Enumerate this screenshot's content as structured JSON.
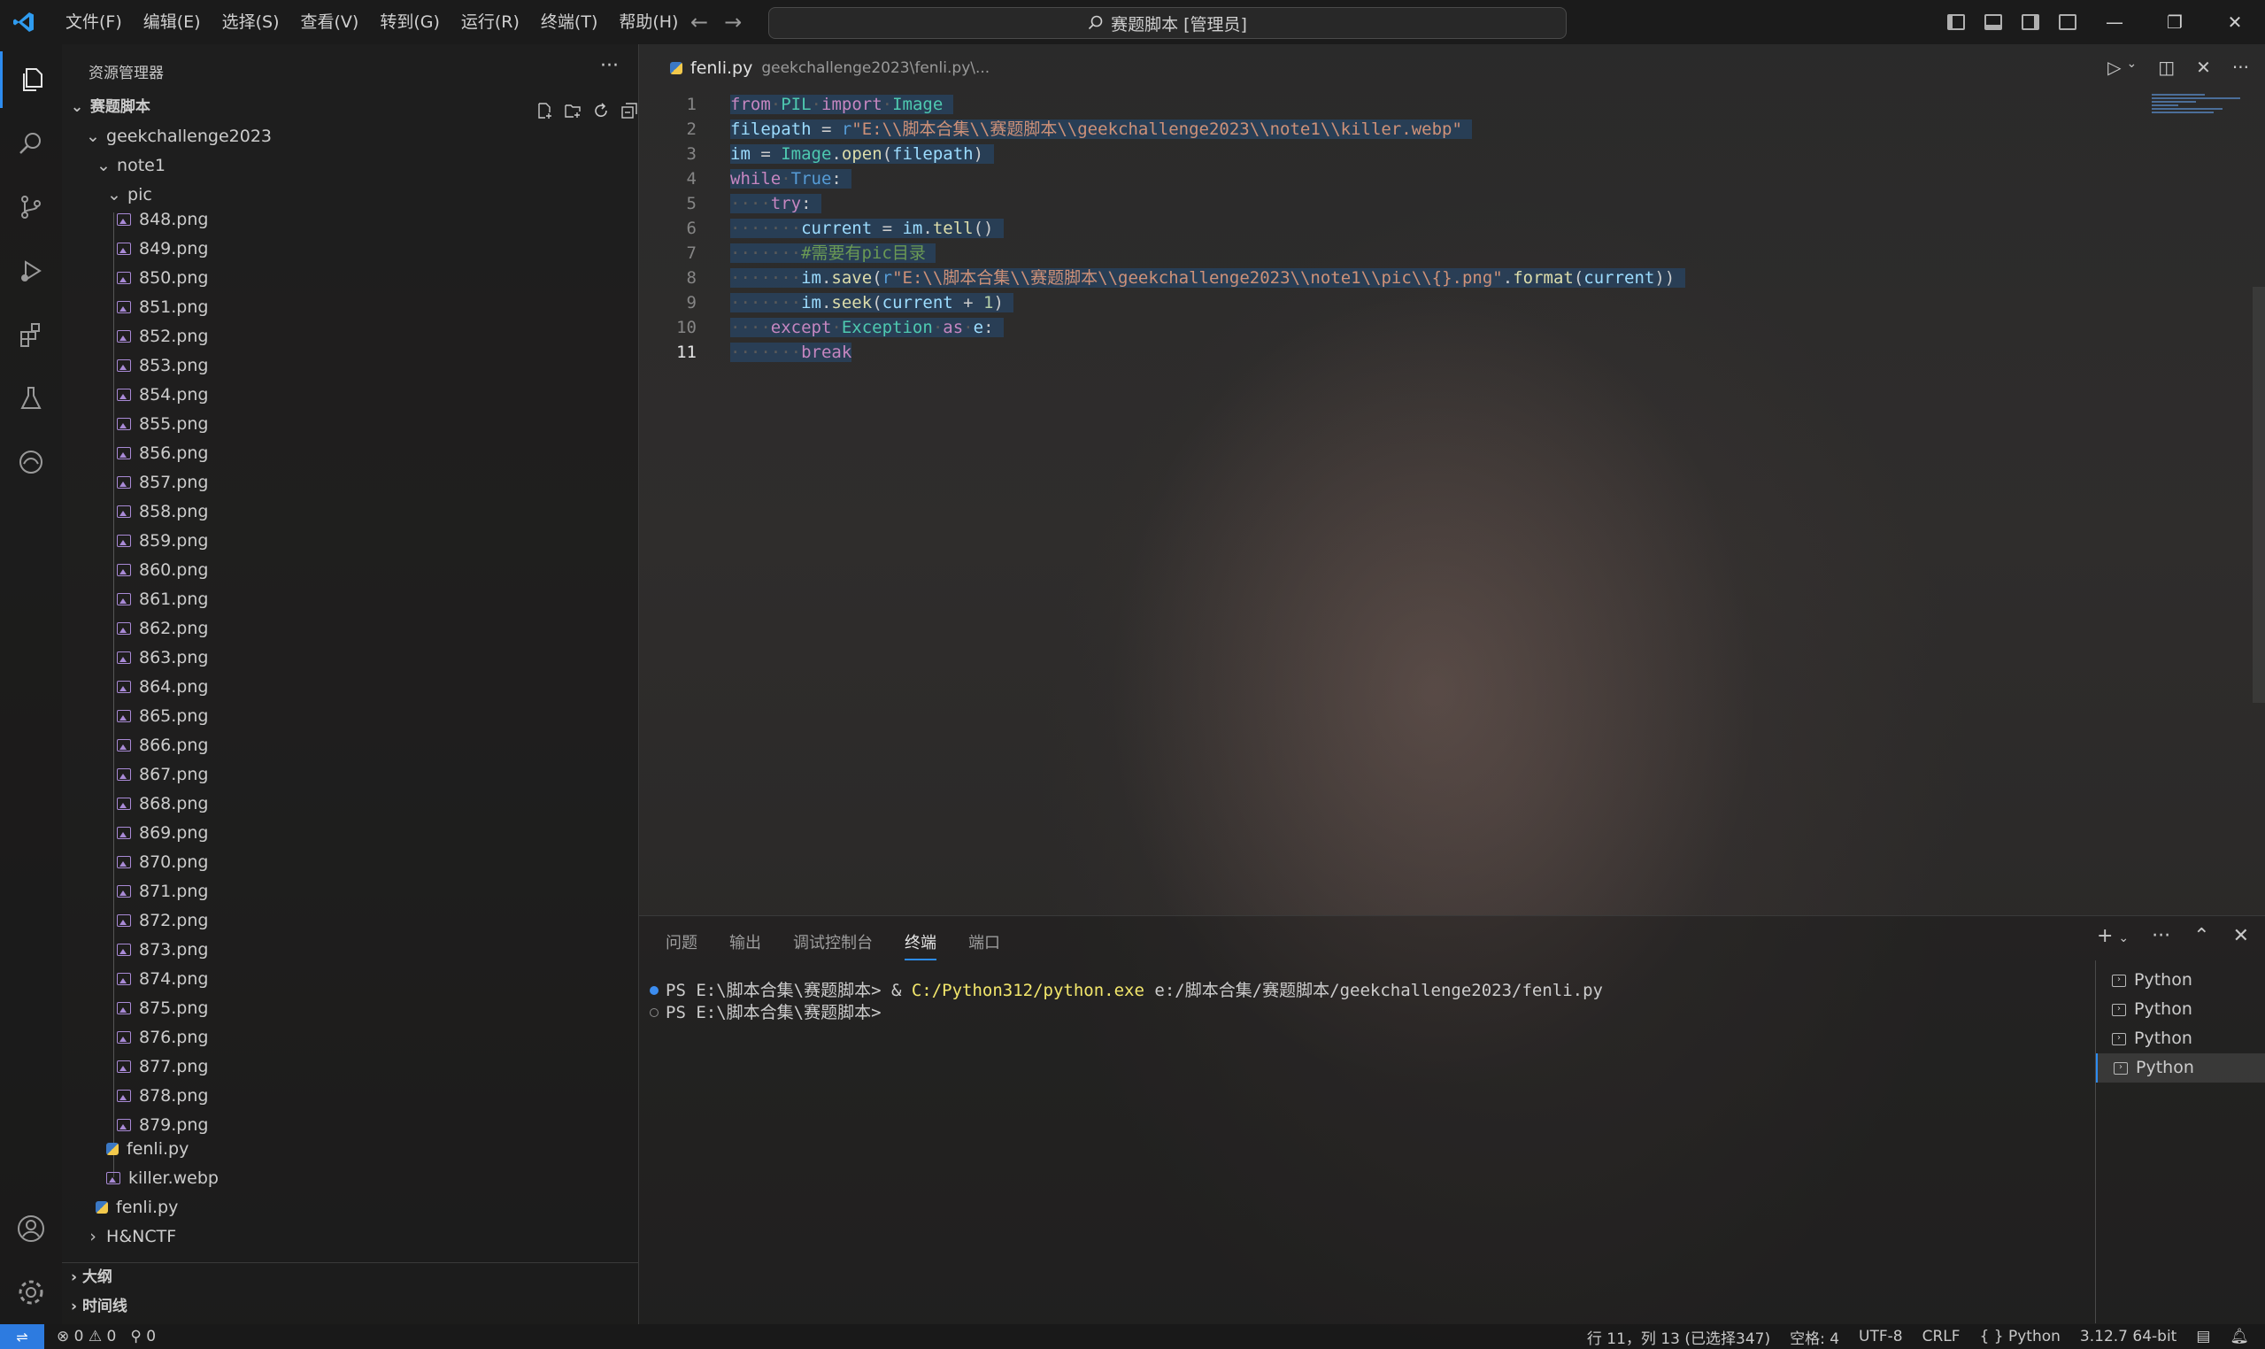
{
  "title_bar": {
    "menu": [
      "文件(F)",
      "编辑(E)",
      "选择(S)",
      "查看(V)",
      "转到(G)",
      "运行(R)",
      "终端(T)",
      "帮助(H)"
    ],
    "search_text": "赛题脚本 [管理员]"
  },
  "sidebar": {
    "header": "资源管理器",
    "project": "赛题脚本",
    "folder": "geekchallenge2023",
    "subfolder": "note1",
    "pic_folder": "pic",
    "files": [
      "848.png",
      "849.png",
      "850.png",
      "851.png",
      "852.png",
      "853.png",
      "854.png",
      "855.png",
      "856.png",
      "857.png",
      "858.png",
      "859.png",
      "860.png",
      "861.png",
      "862.png",
      "863.png",
      "864.png",
      "865.png",
      "866.png",
      "867.png",
      "868.png",
      "869.png",
      "870.png",
      "871.png",
      "872.png",
      "873.png",
      "874.png",
      "875.png",
      "876.png",
      "877.png",
      "878.png",
      "879.png"
    ],
    "note1_files": [
      "fenli.py",
      "killer.webp"
    ],
    "root_file": "fenli.py",
    "other_folder": "H&NCTF",
    "outline": "大纲",
    "timeline": "时间线"
  },
  "editor": {
    "tab_name": "fenli.py",
    "tab_path": "geekchallenge2023\\fenli.py\\...",
    "line_numbers": [
      "1",
      "2",
      "3",
      "4",
      "5",
      "6",
      "7",
      "8",
      "9",
      "10",
      "11"
    ]
  },
  "panel": {
    "tabs": [
      "问题",
      "输出",
      "调试控制台",
      "终端",
      "端口"
    ],
    "active_tab": "终端",
    "term_line1_prompt": "PS E:\\脚本合集\\赛题脚本> & ",
    "term_line1_exe": "C:/Python312/python.exe",
    "term_line1_arg": " e:/脚本合集/赛题脚本/geekchallenge2023/fenli.py",
    "term_line2": "PS E:\\脚本合集\\赛题脚本>",
    "terminals": [
      "Python",
      "Python",
      "Python",
      "Python"
    ]
  },
  "status_bar": {
    "errors": "0",
    "warnings": "0",
    "ports": "0",
    "position": "行 11，列 13 (已选择347)",
    "spaces": "空格: 4",
    "encoding": "UTF-8",
    "eol": "CRLF",
    "language": "Python",
    "interpreter": "3.12.7 64-bit"
  }
}
